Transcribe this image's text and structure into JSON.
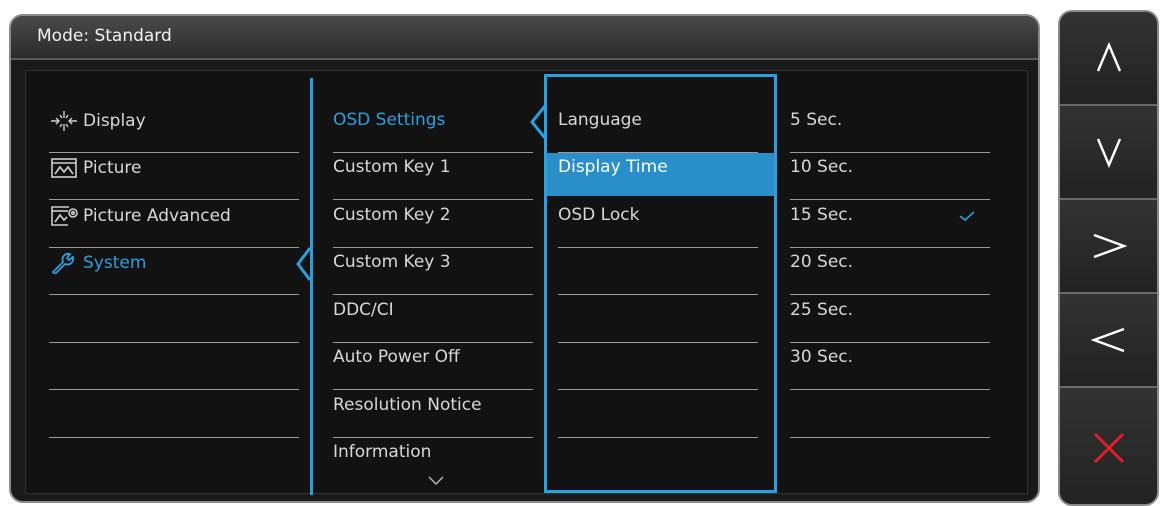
{
  "mode": {
    "text": "Mode: Standard"
  },
  "main_menu": [
    {
      "label": "Display",
      "icon": "display-icon"
    },
    {
      "label": "Picture",
      "icon": "picture-icon"
    },
    {
      "label": "Picture Advanced",
      "icon": "picture-advanced-icon"
    },
    {
      "label": "System",
      "icon": "system-wrench-icon",
      "active": true
    }
  ],
  "sub_menu": [
    {
      "label": "OSD Settings",
      "active": true
    },
    {
      "label": "Custom Key 1"
    },
    {
      "label": "Custom Key 2"
    },
    {
      "label": "Custom Key 3"
    },
    {
      "label": "DDC/CI"
    },
    {
      "label": "Auto Power Off"
    },
    {
      "label": "Resolution Notice"
    },
    {
      "label": "Information"
    }
  ],
  "osd_settings": [
    {
      "label": "Language"
    },
    {
      "label": "Display Time",
      "selected": true
    },
    {
      "label": "OSD Lock"
    }
  ],
  "display_time_options": [
    {
      "label": "5 Sec."
    },
    {
      "label": "10 Sec."
    },
    {
      "label": "15 Sec.",
      "checked": true
    },
    {
      "label": "20 Sec."
    },
    {
      "label": "25 Sec."
    },
    {
      "label": "30 Sec."
    }
  ],
  "side_buttons": [
    "up-caret-icon",
    "down-caret-icon",
    "right-caret-icon",
    "left-caret-icon",
    "close-x-icon"
  ],
  "colors": {
    "accent": "#2aa0e0",
    "highlight": "#2a8fc9",
    "close": "#e0202a"
  }
}
